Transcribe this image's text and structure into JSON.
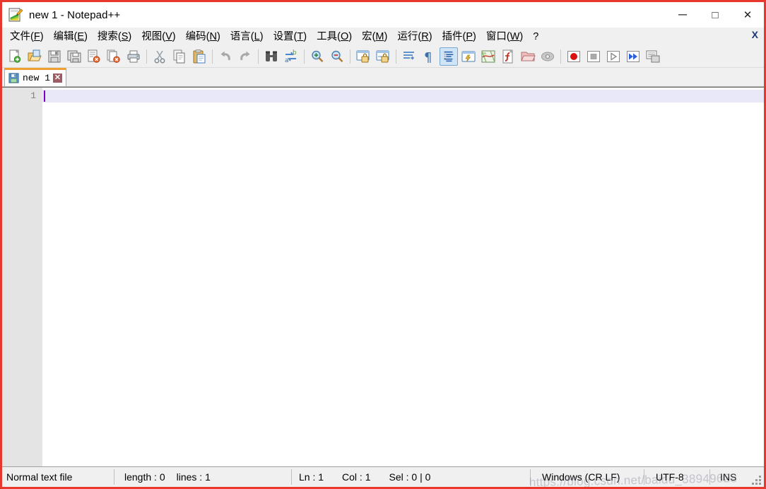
{
  "window": {
    "title": "new 1 - Notepad++",
    "app_icon": "notepad-plus-plus-icon",
    "controls": {
      "minimize": "─",
      "maximize": "□",
      "close": "✕"
    }
  },
  "menubar": {
    "items": [
      {
        "label": "文件(F)",
        "pre": "文件(",
        "accel": "F",
        "post": ")",
        "name": "menu-file"
      },
      {
        "label": "编辑(E)",
        "pre": "编辑(",
        "accel": "E",
        "post": ")",
        "name": "menu-edit"
      },
      {
        "label": "搜索(S)",
        "pre": "搜索(",
        "accel": "S",
        "post": ")",
        "name": "menu-search"
      },
      {
        "label": "视图(V)",
        "pre": "视图(",
        "accel": "V",
        "post": ")",
        "name": "menu-view"
      },
      {
        "label": "编码(N)",
        "pre": "编码(",
        "accel": "N",
        "post": ")",
        "name": "menu-encoding"
      },
      {
        "label": "语言(L)",
        "pre": "语言(",
        "accel": "L",
        "post": ")",
        "name": "menu-language"
      },
      {
        "label": "设置(T)",
        "pre": "设置(",
        "accel": "T",
        "post": ")",
        "name": "menu-settings"
      },
      {
        "label": "工具(O)",
        "pre": "工具(",
        "accel": "O",
        "post": ")",
        "name": "menu-tools"
      },
      {
        "label": "宏(M)",
        "pre": "宏(",
        "accel": "M",
        "post": ")",
        "name": "menu-macro"
      },
      {
        "label": "运行(R)",
        "pre": "运行(",
        "accel": "R",
        "post": ")",
        "name": "menu-run"
      },
      {
        "label": "插件(P)",
        "pre": "插件(",
        "accel": "P",
        "post": ")",
        "name": "menu-plugins"
      },
      {
        "label": "窗口(W)",
        "pre": "窗口(",
        "accel": "W",
        "post": ")",
        "name": "menu-window"
      },
      {
        "label": "?",
        "pre": "?",
        "accel": "",
        "post": "",
        "name": "menu-help"
      }
    ],
    "doc_close_label": "X"
  },
  "toolbar": {
    "buttons": [
      {
        "name": "new-file-icon",
        "tip": "New"
      },
      {
        "name": "open-file-icon",
        "tip": "Open"
      },
      {
        "name": "save-icon",
        "tip": "Save"
      },
      {
        "name": "save-all-icon",
        "tip": "Save All"
      },
      {
        "name": "close-file-icon",
        "tip": "Close"
      },
      {
        "name": "close-all-files-icon",
        "tip": "Close All"
      },
      {
        "name": "print-icon",
        "tip": "Print"
      },
      {
        "name": "separator-1",
        "tip": ""
      },
      {
        "name": "cut-icon",
        "tip": "Cut"
      },
      {
        "name": "copy-icon",
        "tip": "Copy"
      },
      {
        "name": "paste-icon",
        "tip": "Paste"
      },
      {
        "name": "separator-2",
        "tip": ""
      },
      {
        "name": "undo-icon",
        "tip": "Undo"
      },
      {
        "name": "redo-icon",
        "tip": "Redo"
      },
      {
        "name": "separator-3",
        "tip": ""
      },
      {
        "name": "find-icon",
        "tip": "Find"
      },
      {
        "name": "replace-icon",
        "tip": "Replace"
      },
      {
        "name": "separator-4",
        "tip": ""
      },
      {
        "name": "zoom-in-icon",
        "tip": "Zoom In"
      },
      {
        "name": "zoom-out-icon",
        "tip": "Zoom Out"
      },
      {
        "name": "separator-5",
        "tip": ""
      },
      {
        "name": "sync-vertical-scroll-icon",
        "tip": "Synchronize Vertical Scrolling"
      },
      {
        "name": "sync-horizontal-scroll-icon",
        "tip": "Synchronize Horizontal Scrolling"
      },
      {
        "name": "separator-6",
        "tip": ""
      },
      {
        "name": "word-wrap-icon",
        "tip": "Word Wrap"
      },
      {
        "name": "show-all-characters-icon",
        "tip": "Show All Characters"
      },
      {
        "name": "indent-guide-icon",
        "tip": "Show Indent Guide"
      },
      {
        "name": "ui-display-icon",
        "tip": "UI Display"
      },
      {
        "name": "document-map-icon",
        "tip": "Document Map"
      },
      {
        "name": "function-list-icon",
        "tip": "Function List"
      },
      {
        "name": "folder-workspace-icon",
        "tip": "Folder as Workspace"
      },
      {
        "name": "monitoring-icon",
        "tip": "Monitoring"
      },
      {
        "name": "separator-7",
        "tip": ""
      },
      {
        "name": "macro-record-icon",
        "tip": "Start Recording"
      },
      {
        "name": "macro-stop-icon",
        "tip": "Stop Recording"
      },
      {
        "name": "macro-play-icon",
        "tip": "Playback"
      },
      {
        "name": "macro-run-multiple-icon",
        "tip": "Run a Macro Multiple Times"
      },
      {
        "name": "macro-save-icon",
        "tip": "Save Current Recorded Macro"
      }
    ]
  },
  "tabs": [
    {
      "label": "new 1",
      "icon": "save-floppy-icon",
      "close_label": "✕",
      "active": true
    }
  ],
  "editor": {
    "line_numbers": [
      "1"
    ],
    "content": "",
    "caret_line": 1
  },
  "statusbar": {
    "doc_type": "Normal text file",
    "length_label": "length : 0",
    "lines_label": "lines : 1",
    "ln": "Ln : 1",
    "col": "Col : 1",
    "sel": "Sel : 0 | 0",
    "eol": "Windows (CR LF)",
    "encoding": "UTF-8",
    "insert_mode": "INS"
  },
  "watermark": {
    "text": "https://blog.csdn.net/baidu_38949628"
  },
  "colors": {
    "window_border": "#e8372c",
    "toolbar_bg": "#f0f0f0",
    "active_tab_accent": "#f0a030",
    "gutter_bg": "#e4e4e4",
    "current_line_bg": "#e8e8f8",
    "caret": "#8000c8",
    "tab_close_bg": "#9e5b63"
  }
}
